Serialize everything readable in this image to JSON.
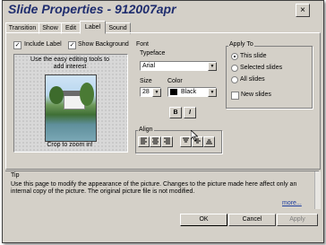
{
  "dialog": {
    "title": "Slide Properties - 912007apr",
    "close_glyph": "×"
  },
  "tabs": [
    {
      "label": "Transition"
    },
    {
      "label": "Show"
    },
    {
      "label": "Edit"
    },
    {
      "label": "Label",
      "active": true
    },
    {
      "label": "Sound"
    }
  ],
  "label_tab": {
    "include_label": {
      "label": "Include Label",
      "checked": true
    },
    "show_background": {
      "label": "Show Background",
      "checked": true
    },
    "preview_hint": "Use the easy editing tools to add interest",
    "preview_caption": "Crop to zoom in!"
  },
  "font": {
    "group_label": "Font",
    "typeface_label": "Typeface",
    "typeface_value": "Arial",
    "size_label": "Size",
    "size_value": "28",
    "color_label": "Color",
    "color_value": "Black",
    "color_swatch": "#000000",
    "bold_label": "B",
    "italic_label": "I"
  },
  "align": {
    "group_label": "Align"
  },
  "apply_to": {
    "group_label": "Apply To",
    "options": [
      {
        "label": "This slide",
        "selected": true
      },
      {
        "label": "Selected slides",
        "selected": false
      },
      {
        "label": "All slides",
        "selected": false
      }
    ],
    "new_slides": {
      "label": "New slides",
      "checked": false
    }
  },
  "tip": {
    "heading": "Tip",
    "text": "Use this page to modify the appearance of the picture. Changes to the picture made here affect only an internal copy of the picture. The original picture file is not modified.",
    "more_link": "more..."
  },
  "buttons": {
    "ok": "OK",
    "cancel": "Cancel",
    "apply": "Apply"
  },
  "colors": {
    "dialog_bg": "#d4d0c8",
    "title_text": "#1f2d6e",
    "link": "#1f3f9f"
  }
}
